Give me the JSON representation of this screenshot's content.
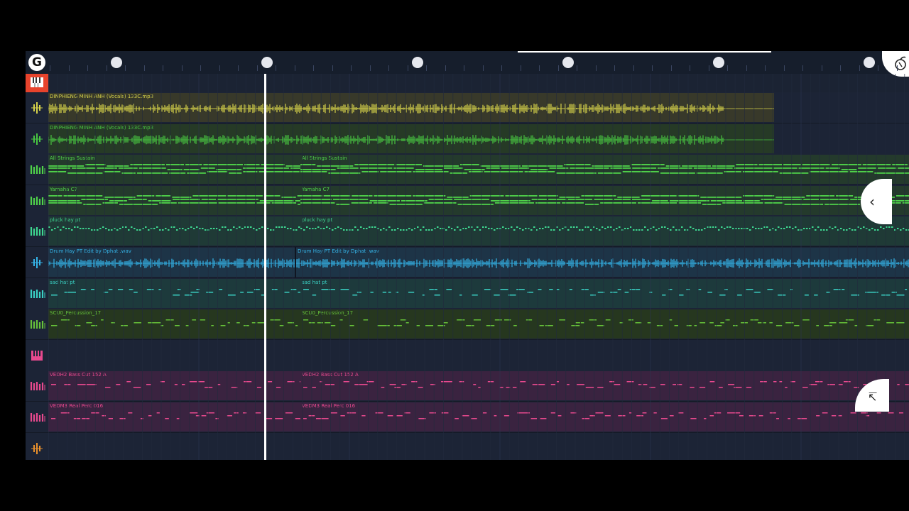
{
  "app": {
    "colors": {
      "background": "#1b2333",
      "ruler": "#161e2c",
      "mixer_button": "#e8432c",
      "playhead": "#ffffff"
    },
    "logo_icon": "fl-logo-icon",
    "mixer_icon": "piano-keys-icon",
    "corner_icon": "fl-fruit-icon"
  },
  "tracks": [
    {
      "icon": "audio-icon",
      "icon_color": "#d6d24a",
      "clips": [
        {
          "name": "DINPHIENG MINH ANH (Vocals) 133C.mp3",
          "color": "#d6d24a",
          "type": "audio",
          "bg": "#38392a"
        }
      ]
    },
    {
      "icon": "audio-icon",
      "icon_color": "#48c442",
      "clips": [
        {
          "name": "DINPHIENG MINH ANH (Vocals) 133C.mp3",
          "color": "#48c442",
          "type": "audio",
          "bg": "#263a26"
        }
      ]
    },
    {
      "icon": "pattern-icon",
      "icon_color": "#4fd24a",
      "clips": [
        {
          "name": "All Strings Sustain",
          "color": "#4fd24a",
          "type": "notes",
          "bg": "#243a2c"
        },
        {
          "name": "All Strings Sustain",
          "color": "#4fd24a",
          "type": "notes",
          "bg": "#243a2c"
        }
      ]
    },
    {
      "icon": "pattern-icon",
      "icon_color": "#4fd24a",
      "clips": [
        {
          "name": "Yamaha C7",
          "color": "#4fd24a",
          "type": "notes",
          "bg": "#243a2c"
        },
        {
          "name": "Yamaha C7",
          "color": "#4fd24a",
          "type": "notes",
          "bg": "#243a2c"
        }
      ]
    },
    {
      "icon": "pattern-icon",
      "icon_color": "#3ed690",
      "clips": [
        {
          "name": "pluck hay pt",
          "color": "#3ed690",
          "type": "dense",
          "bg": "#1f3a36"
        },
        {
          "name": "pluck hay pt",
          "color": "#3ed690",
          "type": "dense",
          "bg": "#1f3a36"
        }
      ]
    },
    {
      "icon": "audio-icon",
      "icon_color": "#35b4e8",
      "clips": [
        {
          "name": "Drum Hay PT Edit by Dphat .wav",
          "color": "#35b4e8",
          "type": "audio",
          "bg": "#1d3447"
        },
        {
          "name": "Drum Hay PT Edit by Dphat .wav",
          "color": "#35b4e8",
          "type": "audio",
          "bg": "#1d3447"
        }
      ]
    },
    {
      "icon": "pattern-icon",
      "icon_color": "#3ad0c4",
      "clips": [
        {
          "name": "sad hat pt",
          "color": "#3ad0c4",
          "type": "sparse",
          "bg": "#1d3a3c"
        },
        {
          "name": "sad hat pt",
          "color": "#3ad0c4",
          "type": "sparse",
          "bg": "#1d3a3c"
        }
      ]
    },
    {
      "icon": "pattern-icon",
      "icon_color": "#66c23a",
      "clips": [
        {
          "name": "SCU0_Percussion_17",
          "color": "#66c23a",
          "type": "sparse",
          "bg": "#26371f"
        },
        {
          "name": "SCU0_Percussion_17",
          "color": "#66c23a",
          "type": "sparse",
          "bg": "#26371f"
        }
      ]
    },
    {
      "icon": "piano-icon",
      "icon_color": "#e8498e",
      "clips": []
    },
    {
      "icon": "pattern-icon",
      "icon_color": "#e8498e",
      "clips": [
        {
          "name": "VEDH2 Bass Cut 152 A",
          "color": "#e8498e",
          "type": "sparse",
          "bg": "#3a2340"
        },
        {
          "name": "VEDH2 Bass Cut 152 A",
          "color": "#e8498e",
          "type": "sparse",
          "bg": "#3a2340"
        }
      ]
    },
    {
      "icon": "pattern-icon",
      "icon_color": "#e8498e",
      "clips": [
        {
          "name": "VEDM3 Real Perc 016",
          "color": "#e8498e",
          "type": "sparse",
          "bg": "#3a2340"
        },
        {
          "name": "VEDM3 Real Perc 016",
          "color": "#e8498e",
          "type": "sparse",
          "bg": "#3a2340"
        }
      ]
    },
    {
      "icon": "audio-icon",
      "icon_color": "#e8902c",
      "clips": []
    }
  ]
}
